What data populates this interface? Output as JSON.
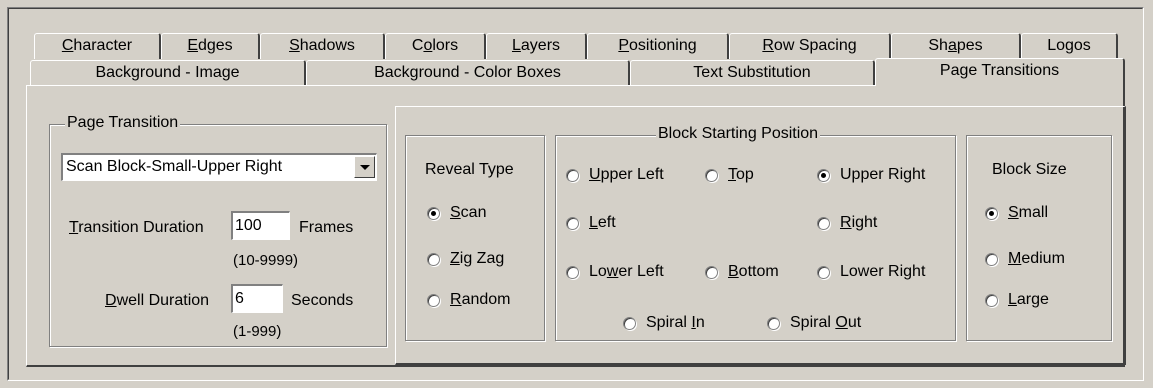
{
  "tabs_row1": [
    {
      "label": "Character",
      "u": "C"
    },
    {
      "label": "Edges",
      "u": "E"
    },
    {
      "label": "Shadows",
      "u": "S"
    },
    {
      "label": "Colors",
      "u": "o"
    },
    {
      "label": "Layers",
      "u": "L"
    },
    {
      "label": "Positioning",
      "u": "P"
    },
    {
      "label": "Row Spacing",
      "u": "R"
    },
    {
      "label": "Shapes",
      "u": "a"
    },
    {
      "label": "Logos",
      "u": "g"
    }
  ],
  "tabs_row2": [
    {
      "label": "Background - Image"
    },
    {
      "label": "Background - Color Boxes"
    },
    {
      "label": "Text Substitution"
    },
    {
      "label": "Page Transitions"
    }
  ],
  "page_transition": {
    "group_label": "Page Transition",
    "selected": "Scan Block-Small-Upper Right",
    "transition_label_u": "T",
    "transition_label_rest": "ransition Duration",
    "transition_value": "100",
    "transition_unit": "Frames",
    "transition_range": "(10-9999)",
    "dwell_label_u": "D",
    "dwell_label_rest": "well Duration",
    "dwell_value": "6",
    "dwell_unit": "Seconds",
    "dwell_range": "(1-999)"
  },
  "reveal_type": {
    "label": "Reveal Type",
    "scan": {
      "u": "S",
      "rest": "can"
    },
    "zigzag": {
      "u": "Z",
      "rest": "ig Zag"
    },
    "random": {
      "u": "R",
      "rest": "andom"
    },
    "selected": "scan"
  },
  "block_start": {
    "label": "Block Starting Position",
    "upper_left": {
      "u": "U",
      "rest": "pper Left"
    },
    "top": {
      "u": "T",
      "rest": "op"
    },
    "upper_right": {
      "label": "Upper Right"
    },
    "left": {
      "u": "L",
      "rest": "eft"
    },
    "right": {
      "u": "R",
      "rest": "ight"
    },
    "lower_left": {
      "pre": "Lo",
      "u": "w",
      "rest": "er Left"
    },
    "bottom": {
      "u": "B",
      "rest": "ottom"
    },
    "lower_right": {
      "pre": "Lower Ri",
      "u": "g",
      "rest": "ht"
    },
    "spiral_in": {
      "pre": "Spiral ",
      "u": "I",
      "rest": "n"
    },
    "spiral_out": {
      "pre": "Spiral ",
      "u": "O",
      "rest": "ut"
    },
    "selected": "upper_right"
  },
  "block_size": {
    "label": "Block Size",
    "small": {
      "u": "S",
      "rest": "mall"
    },
    "medium": {
      "u": "M",
      "rest": "edium"
    },
    "large": {
      "u": "L",
      "rest": "arge"
    },
    "selected": "small"
  }
}
